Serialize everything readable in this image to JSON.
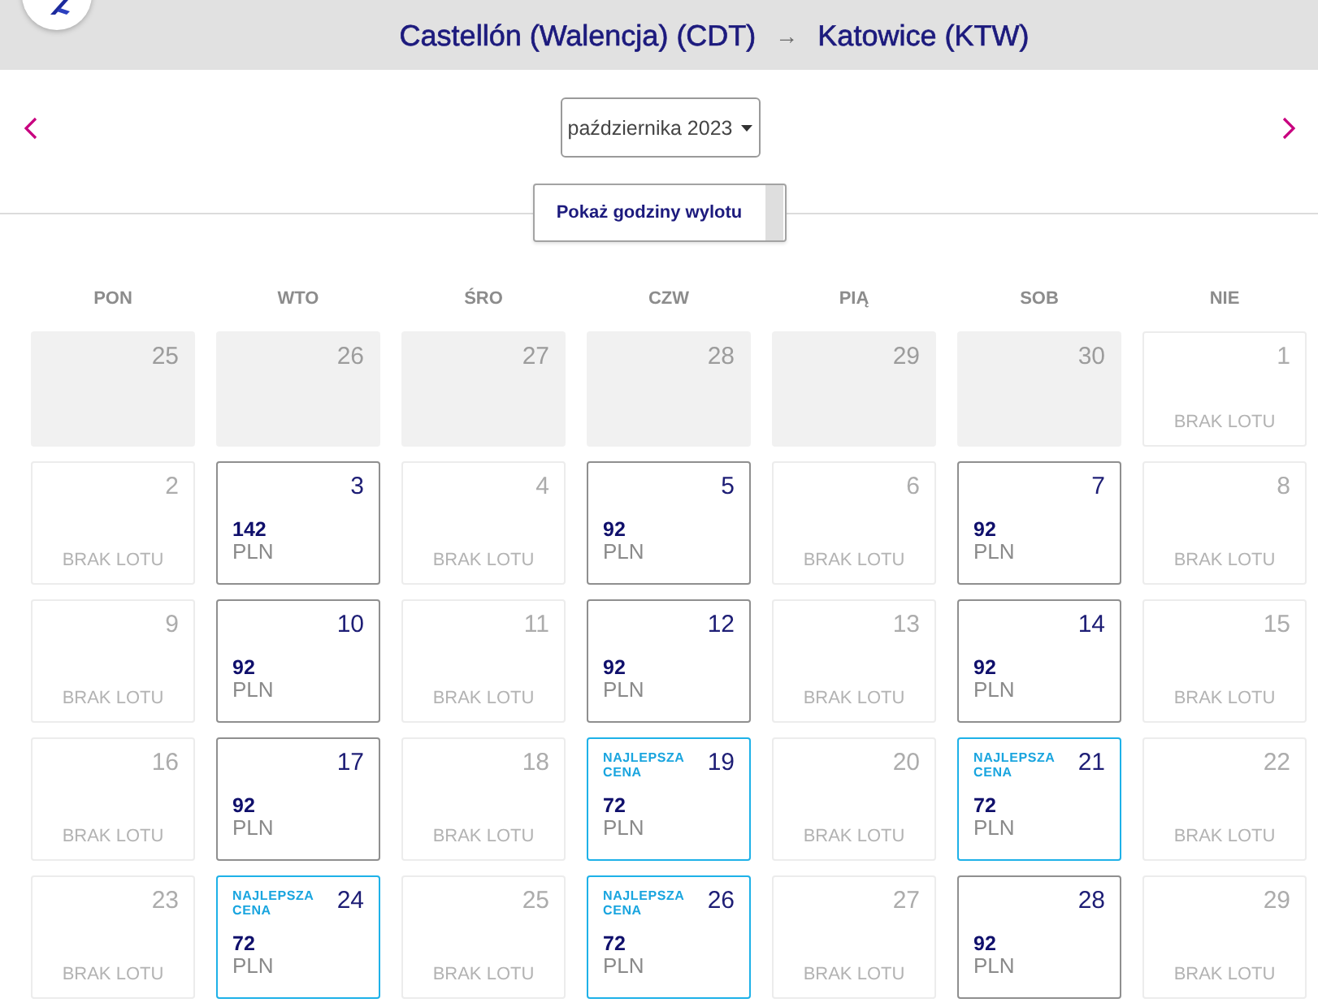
{
  "header": {
    "origin": "Castellón (Walencja) (CDT)",
    "arrow": "→",
    "destination": "Katowice (KTW)"
  },
  "month_picker": {
    "value": "października 2023"
  },
  "departure_times_button": {
    "label": "Pokaż godziny wylotu"
  },
  "weekdays": [
    "PON",
    "WTO",
    "ŚRO",
    "CZW",
    "PIĄ",
    "SOB",
    "NIE"
  ],
  "weeks": [
    [
      {
        "kind": "outside",
        "day": "25"
      },
      {
        "kind": "outside",
        "day": "26"
      },
      {
        "kind": "outside",
        "day": "27"
      },
      {
        "kind": "outside",
        "day": "28"
      },
      {
        "kind": "outside",
        "day": "29"
      },
      {
        "kind": "outside",
        "day": "30"
      },
      {
        "kind": "no_flight",
        "day": "1",
        "note": "BRAK LOTU"
      }
    ],
    [
      {
        "kind": "no_flight",
        "day": "2",
        "note": "BRAK LOTU"
      },
      {
        "kind": "fare",
        "day": "3",
        "price": "142",
        "currency": "PLN"
      },
      {
        "kind": "no_flight",
        "day": "4",
        "note": "BRAK LOTU"
      },
      {
        "kind": "fare",
        "day": "5",
        "price": "92",
        "currency": "PLN"
      },
      {
        "kind": "no_flight",
        "day": "6",
        "note": "BRAK LOTU"
      },
      {
        "kind": "fare",
        "day": "7",
        "price": "92",
        "currency": "PLN"
      },
      {
        "kind": "no_flight",
        "day": "8",
        "note": "BRAK LOTU"
      }
    ],
    [
      {
        "kind": "no_flight",
        "day": "9",
        "note": "BRAK LOTU"
      },
      {
        "kind": "fare",
        "day": "10",
        "price": "92",
        "currency": "PLN"
      },
      {
        "kind": "no_flight",
        "day": "11",
        "note": "BRAK LOTU"
      },
      {
        "kind": "fare",
        "day": "12",
        "price": "92",
        "currency": "PLN"
      },
      {
        "kind": "no_flight",
        "day": "13",
        "note": "BRAK LOTU"
      },
      {
        "kind": "fare",
        "day": "14",
        "price": "92",
        "currency": "PLN"
      },
      {
        "kind": "no_flight",
        "day": "15",
        "note": "BRAK LOTU"
      }
    ],
    [
      {
        "kind": "no_flight",
        "day": "16",
        "note": "BRAK LOTU"
      },
      {
        "kind": "fare",
        "day": "17",
        "price": "92",
        "currency": "PLN"
      },
      {
        "kind": "no_flight",
        "day": "18",
        "note": "BRAK LOTU"
      },
      {
        "kind": "best_fare",
        "day": "19",
        "badge": "NAJLEPSZA CENA",
        "price": "72",
        "currency": "PLN"
      },
      {
        "kind": "no_flight",
        "day": "20",
        "note": "BRAK LOTU"
      },
      {
        "kind": "best_fare",
        "day": "21",
        "badge": "NAJLEPSZA CENA",
        "price": "72",
        "currency": "PLN"
      },
      {
        "kind": "no_flight",
        "day": "22",
        "note": "BRAK LOTU"
      }
    ],
    [
      {
        "kind": "no_flight",
        "day": "23",
        "note": "BRAK LOTU"
      },
      {
        "kind": "best_fare",
        "day": "24",
        "badge": "NAJLEPSZA CENA",
        "price": "72",
        "currency": "PLN"
      },
      {
        "kind": "no_flight",
        "day": "25",
        "note": "BRAK LOTU"
      },
      {
        "kind": "best_fare",
        "day": "26",
        "badge": "NAJLEPSZA CENA",
        "price": "72",
        "currency": "PLN"
      },
      {
        "kind": "no_flight",
        "day": "27",
        "note": "BRAK LOTU"
      },
      {
        "kind": "fare",
        "day": "28",
        "price": "92",
        "currency": "PLN"
      },
      {
        "kind": "no_flight",
        "day": "29",
        "note": "BRAK LOTU"
      }
    ]
  ]
}
